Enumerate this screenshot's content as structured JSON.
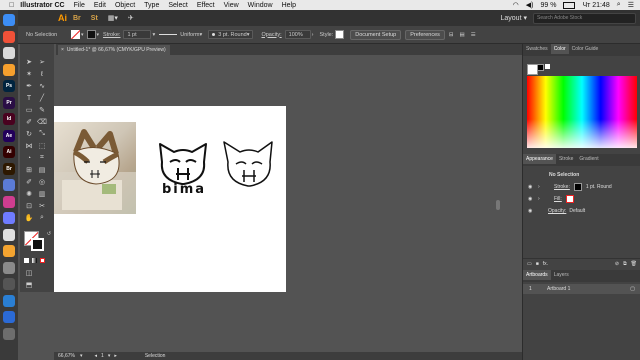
{
  "menubar": {
    "app_name": "Illustrator CC",
    "items": [
      "File",
      "Edit",
      "Object",
      "Type",
      "Select",
      "Effect",
      "View",
      "Window",
      "Help"
    ],
    "battery": "99 %",
    "clock": "Чт 21:48"
  },
  "appbar": {
    "logo": "Ai",
    "layout": "Layout",
    "search_placeholder": "Search Adobe Stock"
  },
  "controlbar": {
    "selection": "No Selection",
    "stroke_label": "Stroke:",
    "stroke_value": "1 pt",
    "profile": "Uniform",
    "brush": "3 pt. Round",
    "opacity_label": "Opacity:",
    "opacity_value": "100%",
    "style_label": "Style:",
    "doc_setup": "Document Setup",
    "preferences": "Preferences"
  },
  "document": {
    "tab_title": "Untitled-1* @ 66,67% (CMYK/GPU Preview)",
    "close": "×"
  },
  "artwork": {
    "caption": "bima"
  },
  "status": {
    "zoom": "66,67%",
    "artboard_num": "1",
    "tool": "Selection"
  },
  "swatches_panel": {
    "tabs": [
      "Swatches",
      "Color",
      "Color Guide"
    ],
    "active": "Color"
  },
  "appearance_panel": {
    "tabs": [
      "Appearance",
      "Stroke",
      "Gradient"
    ],
    "title": "No Selection",
    "stroke_label": "Stroke:",
    "stroke_value": "1 pt. Round",
    "fill_label": "Fill:",
    "opacity_label": "Opacity:",
    "opacity_value": "Default",
    "fx": "fx."
  },
  "artboards_panel": {
    "tabs": [
      "Artboards",
      "Layers"
    ],
    "rows": [
      {
        "num": "1",
        "name": "Artboard 1"
      }
    ]
  },
  "dock_icons": [
    {
      "label": "",
      "color": "#3c8df5"
    },
    {
      "label": "",
      "color": "#f05138"
    },
    {
      "label": "",
      "color": "#d9d9d9"
    },
    {
      "label": "",
      "color": "#f7a02d"
    },
    {
      "label": "Ps",
      "color": "#00243f"
    },
    {
      "label": "Pr",
      "color": "#2a0e45"
    },
    {
      "label": "Id",
      "color": "#49021f"
    },
    {
      "label": "Ae",
      "color": "#22005a"
    },
    {
      "label": "Ai",
      "color": "#330000"
    },
    {
      "label": "Br",
      "color": "#2d1800"
    },
    {
      "label": "",
      "color": "#5b7bd5"
    },
    {
      "label": "",
      "color": "#cf3d8f"
    },
    {
      "label": "",
      "color": "#6f7cff"
    },
    {
      "label": "",
      "color": "#e0e0e0"
    },
    {
      "label": "",
      "color": "#f4a430"
    },
    {
      "label": "",
      "color": "#8a8a8a"
    },
    {
      "label": "",
      "color": "#555"
    },
    {
      "label": "",
      "color": "#2a7fd4"
    },
    {
      "label": "",
      "color": "#2b6ad6"
    },
    {
      "label": "",
      "color": "#6d6d6d"
    }
  ],
  "colors": {
    "accent": "#ff9a00",
    "panel": "#434343",
    "canvas": "#535353"
  }
}
